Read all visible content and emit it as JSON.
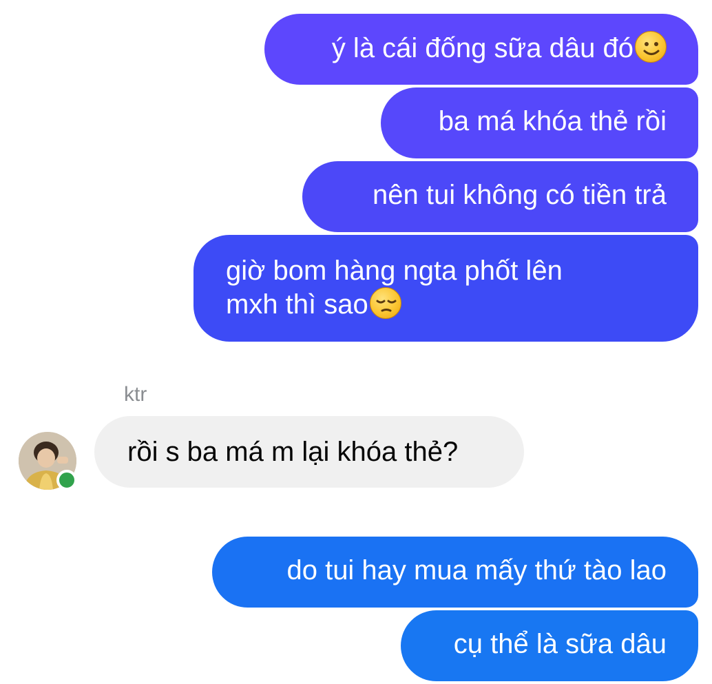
{
  "colors": {
    "outgoing_gradient_top": "#5b45ff",
    "outgoing_gradient_bottom": "#1877f2",
    "incoming_bubble": "#f0f0f0",
    "online_indicator": "#31a24c"
  },
  "messages_top": [
    {
      "text": "ý là cái đống sữa dâu đó",
      "emoji": "slightly-smiling-face-icon"
    },
    {
      "text": "ba má khóa thẻ rồi"
    },
    {
      "text": "nên tui không có tiền trả"
    },
    {
      "lines": [
        "giờ bom hàng ngta phốt lên",
        "mxh thì sao"
      ],
      "emoji": "pensive-face-icon"
    }
  ],
  "incoming": {
    "sender_name": "ktr",
    "text": "rồi s ba má m lại khóa thẻ?",
    "online": true
  },
  "messages_bottom": [
    {
      "text": "do tui hay mua mấy thứ tào lao"
    },
    {
      "text": "cụ thể là sữa dâu"
    }
  ]
}
